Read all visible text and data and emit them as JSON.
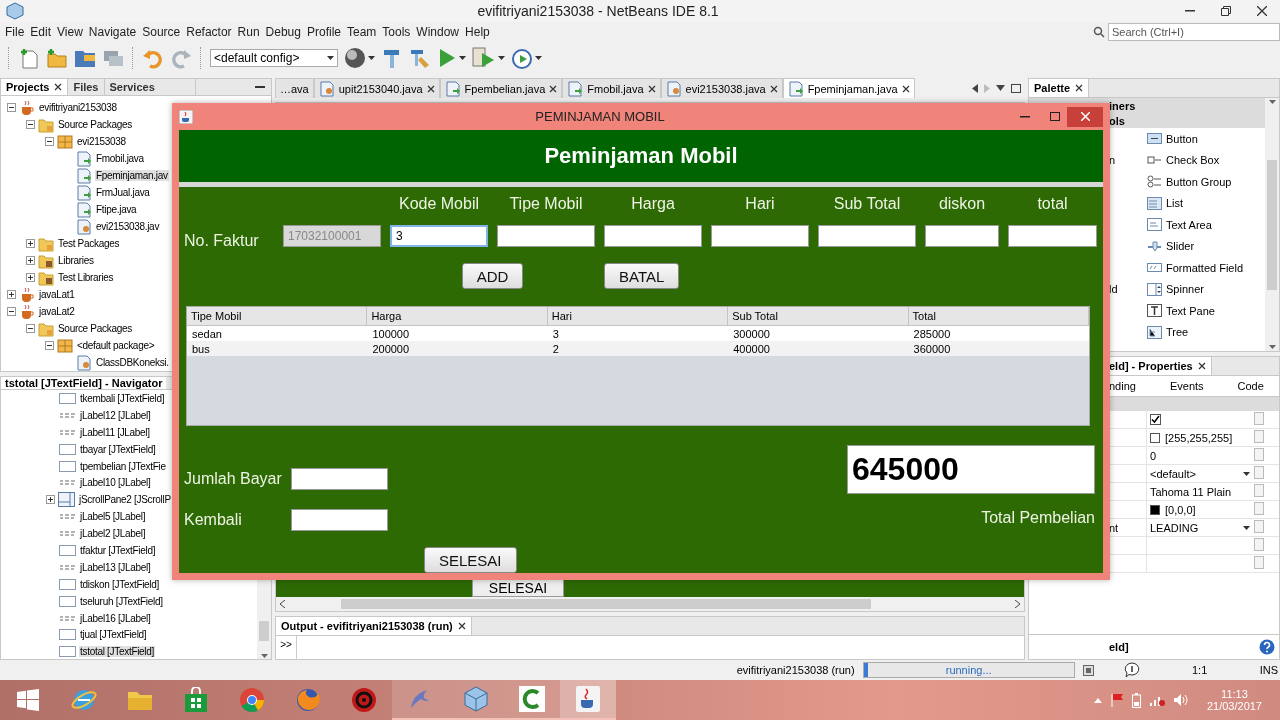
{
  "window": {
    "title": "evifitriyani2153038 - NetBeans IDE 8.1"
  },
  "menu": [
    "File",
    "Edit",
    "View",
    "Navigate",
    "Source",
    "Refactor",
    "Run",
    "Debug",
    "Profile",
    "Team",
    "Tools",
    "Window",
    "Help"
  ],
  "search": {
    "placeholder": "Search (Ctrl+I)"
  },
  "toolbar": {
    "config": "<default config>"
  },
  "projects_panel": {
    "tabs": [
      {
        "label": "Projects",
        "selected": true
      },
      {
        "label": "Files",
        "selected": false
      },
      {
        "label": "Services",
        "selected": false
      }
    ],
    "tree": [
      {
        "label": "evifitriyani2153038",
        "kind": "project",
        "expanded": true,
        "selected": false,
        "children": [
          {
            "label": "Source Packages",
            "kind": "folder",
            "expanded": true,
            "selected": false,
            "children": [
              {
                "label": "evi2153038",
                "kind": "package",
                "expanded": true,
                "selected": false,
                "children": [
                  {
                    "label": "Fmobil.java",
                    "kind": "form",
                    "selected": false
                  },
                  {
                    "label": "Fpeminjaman.jav",
                    "kind": "form",
                    "selected": true
                  },
                  {
                    "label": "FrmJual.java",
                    "kind": "form",
                    "selected": false
                  },
                  {
                    "label": "Ftipe.java",
                    "kind": "form",
                    "selected": false
                  },
                  {
                    "label": "evi2153038.jav",
                    "kind": "class",
                    "selected": false
                  }
                ]
              }
            ]
          },
          {
            "label": "Test Packages",
            "kind": "folder",
            "expanded": false,
            "selected": false
          },
          {
            "label": "Libraries",
            "kind": "library",
            "expanded": false,
            "selected": false
          },
          {
            "label": "Test Libraries",
            "kind": "library",
            "expanded": false,
            "selected": false
          }
        ]
      },
      {
        "label": "javaLat1",
        "kind": "project",
        "expanded": false,
        "selected": false
      },
      {
        "label": "javaLat2",
        "kind": "project",
        "expanded": true,
        "selected": false,
        "children": [
          {
            "label": "Source Packages",
            "kind": "folder",
            "expanded": true,
            "selected": false,
            "children": [
              {
                "label": "<default package>",
                "kind": "package",
                "expanded": true,
                "selected": false,
                "children": [
                  {
                    "label": "ClassDBKoneksi.",
                    "kind": "class",
                    "selected": false
                  }
                ]
              }
            ]
          }
        ]
      }
    ]
  },
  "navigator": {
    "title": "tstotal [JTextField] - Navigator",
    "items": [
      {
        "label": "tkembali [JTextField]",
        "kind": "field",
        "selected": false
      },
      {
        "label": "jLabel12 [JLabel]",
        "kind": "label",
        "selected": false
      },
      {
        "label": "jLabel11 [JLabel]",
        "kind": "label",
        "selected": false
      },
      {
        "label": "tbayar [JTextField]",
        "kind": "field",
        "selected": false
      },
      {
        "label": "tpembelian [JTextFie",
        "kind": "field",
        "selected": false
      },
      {
        "label": "jLabel10 [JLabel]",
        "kind": "label",
        "selected": false
      },
      {
        "label": "jScrollPane2 [JScrollP",
        "kind": "scroll",
        "expanded": false,
        "selected": false
      },
      {
        "label": "jLabel5 [JLabel]",
        "kind": "label",
        "selected": false
      },
      {
        "label": "jLabel2 [JLabel]",
        "kind": "label",
        "selected": false
      },
      {
        "label": "tfaktur [JTextField]",
        "kind": "field",
        "selected": false
      },
      {
        "label": "jLabel13 [JLabel]",
        "kind": "label",
        "selected": false
      },
      {
        "label": "tdiskon [JTextField]",
        "kind": "field",
        "selected": false
      },
      {
        "label": "tseluruh [JTextField]",
        "kind": "field",
        "selected": false
      },
      {
        "label": "jLabel16 [JLabel]",
        "kind": "label",
        "selected": false
      },
      {
        "label": "tjual [JTextField]",
        "kind": "field",
        "selected": false
      },
      {
        "label": "tstotal [JTextField]",
        "kind": "field",
        "selected": true
      }
    ]
  },
  "editor": {
    "overflow_tab": "…ava",
    "tabs": [
      {
        "label": "upit2153040.java",
        "kind": "class",
        "selected": false
      },
      {
        "label": "Fpembelian.java",
        "kind": "form",
        "selected": false
      },
      {
        "label": "Fmobil.java",
        "kind": "form",
        "selected": false
      },
      {
        "label": "evi2153038.java",
        "kind": "class",
        "selected": false
      },
      {
        "label": "Fpeminjaman.java",
        "kind": "form",
        "selected": true
      }
    ],
    "behind_button": "SELESAI"
  },
  "output": {
    "title": "Output - evifitriyani2153038 (run)",
    "rerun": ">>"
  },
  "palette": {
    "title": "Palette",
    "categories": [
      "iners",
      "ols"
    ],
    "items": [
      {
        "label": "Button",
        "kind": "button"
      },
      {
        "label": "Check Box",
        "kind": "checkbox",
        "side": "n"
      },
      {
        "label": "Button Group",
        "kind": "group"
      },
      {
        "label": "List",
        "kind": "list"
      },
      {
        "label": "Text Area",
        "kind": "textarea"
      },
      {
        "label": "Slider",
        "kind": "slider"
      },
      {
        "label": "Formatted Field",
        "kind": "formatted"
      },
      {
        "label": "Spinner",
        "kind": "spinner",
        "side": "ld"
      },
      {
        "label": "Text Pane",
        "kind": "textpane"
      },
      {
        "label": "Tree",
        "kind": "tree"
      }
    ]
  },
  "properties": {
    "title": "eld] - Properties",
    "tabs": [
      "nding",
      "Events",
      "Code"
    ],
    "rows": [
      {
        "kind": "checkbox",
        "checked": true
      },
      {
        "kind": "color",
        "color": "#ffffff",
        "value": "[255,255,255]"
      },
      {
        "kind": "text",
        "value": "0"
      },
      {
        "kind": "dropdown",
        "value": "<default>"
      },
      {
        "kind": "text",
        "value": "Tahoma 11 Plain"
      },
      {
        "kind": "color",
        "color": "#000000",
        "value": "[0,0,0]"
      },
      {
        "kind": "dropdown",
        "value": "LEADING",
        "name": "nt"
      },
      {
        "kind": "empty"
      },
      {
        "kind": "empty"
      }
    ],
    "footer": "eld]"
  },
  "dialog": {
    "title": "PEMINJAMAN MOBIL",
    "heading": "Peminjaman Mobil",
    "faktur_label": "No. Faktur",
    "faktur": {
      "value": "17032100001",
      "disabled": true
    },
    "columns": [
      {
        "label": "Kode Mobil",
        "value": "3",
        "focused": true
      },
      {
        "label": "Tipe Mobil",
        "focused": false
      },
      {
        "label": "Harga",
        "focused": false
      },
      {
        "label": "Hari",
        "focused": false
      },
      {
        "label": "Sub Total",
        "focused": false
      },
      {
        "label": "diskon",
        "focused": false
      },
      {
        "label": "total",
        "focused": false
      }
    ],
    "add_button": "ADD",
    "cancel_button": "BATAL",
    "table": {
      "columns": [
        "Tipe Mobil",
        "Harga",
        "Hari",
        "Sub Total",
        "Total"
      ],
      "rows": [
        [
          "sedan",
          "100000",
          "3",
          "300000",
          "285000"
        ],
        [
          "bus",
          "200000",
          "2",
          "400000",
          "360000"
        ]
      ]
    },
    "payment_label": "Jumlah Bayar",
    "change_label": "Kembali",
    "finish_button": "SELESAI",
    "total": "645000",
    "total_label": "Total Pembelian"
  },
  "status_bar": {
    "process": "evifitriyani2153038 (run)",
    "progress": "running...",
    "level": 0.02,
    "position": "1:1",
    "mode": "INS"
  },
  "taskbar": {
    "apps": [
      {
        "kind": "start",
        "running": false,
        "selected": false
      },
      {
        "kind": "ie",
        "running": false,
        "selected": false
      },
      {
        "kind": "folder",
        "running": false,
        "selected": false
      },
      {
        "kind": "store",
        "running": false,
        "selected": false
      },
      {
        "kind": "chrome",
        "running": false,
        "selected": false
      },
      {
        "kind": "firefox",
        "running": false,
        "selected": false
      },
      {
        "kind": "red",
        "running": false,
        "selected": false
      },
      {
        "kind": "dolphin",
        "running": true,
        "selected": false
      },
      {
        "kind": "cube",
        "running": true,
        "selected": false
      },
      {
        "kind": "camtasia",
        "running": true,
        "selected": false
      },
      {
        "kind": "java",
        "running": true,
        "selected": true
      }
    ],
    "time": "11:13",
    "date": "21/03/2017"
  }
}
